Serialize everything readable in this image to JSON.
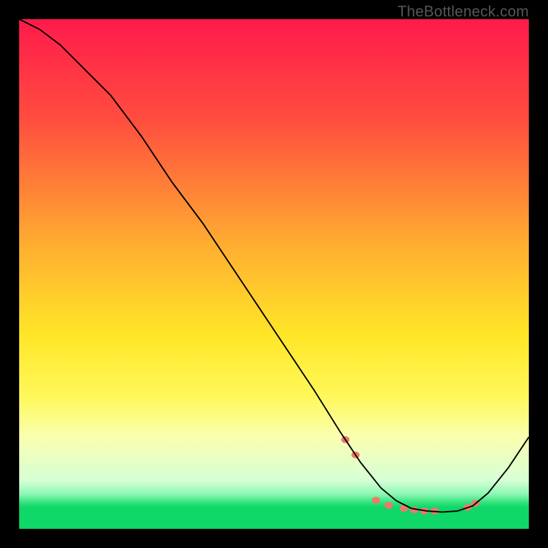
{
  "watermark": "TheBottleneck.com",
  "chart_data": {
    "type": "line",
    "title": "",
    "xlabel": "",
    "ylabel": "",
    "xlim": [
      0,
      100
    ],
    "ylim": [
      0,
      100
    ],
    "background_gradient_stops": [
      {
        "pos": 0.0,
        "color": "#ff1a4b"
      },
      {
        "pos": 0.2,
        "color": "#ff4e3f"
      },
      {
        "pos": 0.45,
        "color": "#ffb030"
      },
      {
        "pos": 0.62,
        "color": "#ffe627"
      },
      {
        "pos": 0.74,
        "color": "#fff85a"
      },
      {
        "pos": 0.82,
        "color": "#faffb0"
      },
      {
        "pos": 0.905,
        "color": "#d6ffd6"
      },
      {
        "pos": 0.932,
        "color": "#8cf7b4"
      },
      {
        "pos": 0.948,
        "color": "#34e47d"
      },
      {
        "pos": 0.958,
        "color": "#0fd768"
      },
      {
        "pos": 1.0,
        "color": "#0fd768"
      }
    ],
    "series": [
      {
        "name": "bottleneck-curve",
        "color": "#000000",
        "stroke_width": 2,
        "x": [
          0,
          4,
          8,
          12,
          18,
          24,
          30,
          36,
          42,
          48,
          54,
          58,
          63,
          67,
          71,
          74,
          77,
          80,
          83,
          86,
          89,
          92,
          96,
          100
        ],
        "y": [
          100,
          98,
          95,
          91,
          85,
          77,
          68,
          60,
          51,
          42,
          33,
          27,
          19,
          13,
          8,
          5.5,
          4.0,
          3.5,
          3.3,
          3.5,
          4.5,
          7.0,
          12,
          18
        ]
      }
    ],
    "markers": {
      "name": "highlight-dots",
      "color": "#f1776b",
      "rx": 6,
      "ry": 5,
      "points_x": [
        64,
        66,
        70,
        72.5,
        75.5,
        77.5,
        79.5,
        81.5,
        88,
        89.5
      ],
      "points_y": [
        17.5,
        14.5,
        5.6,
        4.6,
        4.0,
        3.7,
        3.5,
        3.5,
        4.2,
        5.0
      ]
    }
  }
}
